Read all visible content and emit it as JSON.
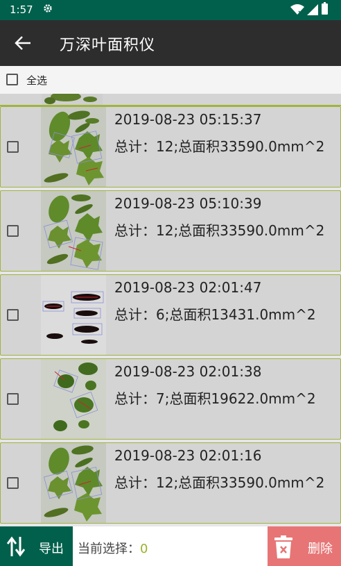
{
  "status_bar": {
    "time": "1:57"
  },
  "app_bar": {
    "title": "万深叶面积仪"
  },
  "select_all": {
    "label": "全选"
  },
  "records": [
    {
      "timestamp": "2019-08-23 05:15:37",
      "summary": "总计：12;总面积33590.0mm^2"
    },
    {
      "timestamp": "2019-08-23 05:10:39",
      "summary": "总计：12;总面积33590.0mm^2"
    },
    {
      "timestamp": "2019-08-23 02:01:47",
      "summary": "总计：6;总面积13431.0mm^2"
    },
    {
      "timestamp": "2019-08-23 02:01:38",
      "summary": "总计：7;总面积19622.0mm^2"
    },
    {
      "timestamp": "2019-08-23 02:01:16",
      "summary": "总计：12;总面积33590.0mm^2"
    }
  ],
  "bottom_bar": {
    "export_label": "导出",
    "selection_label": "当前选择：",
    "selection_count": "0",
    "delete_label": "删除"
  },
  "colors": {
    "status_bar": "#00604c",
    "app_bar": "#2d2d2d",
    "row_border": "#9fb43d",
    "delete": "#e77575",
    "count": "#98b22a"
  }
}
